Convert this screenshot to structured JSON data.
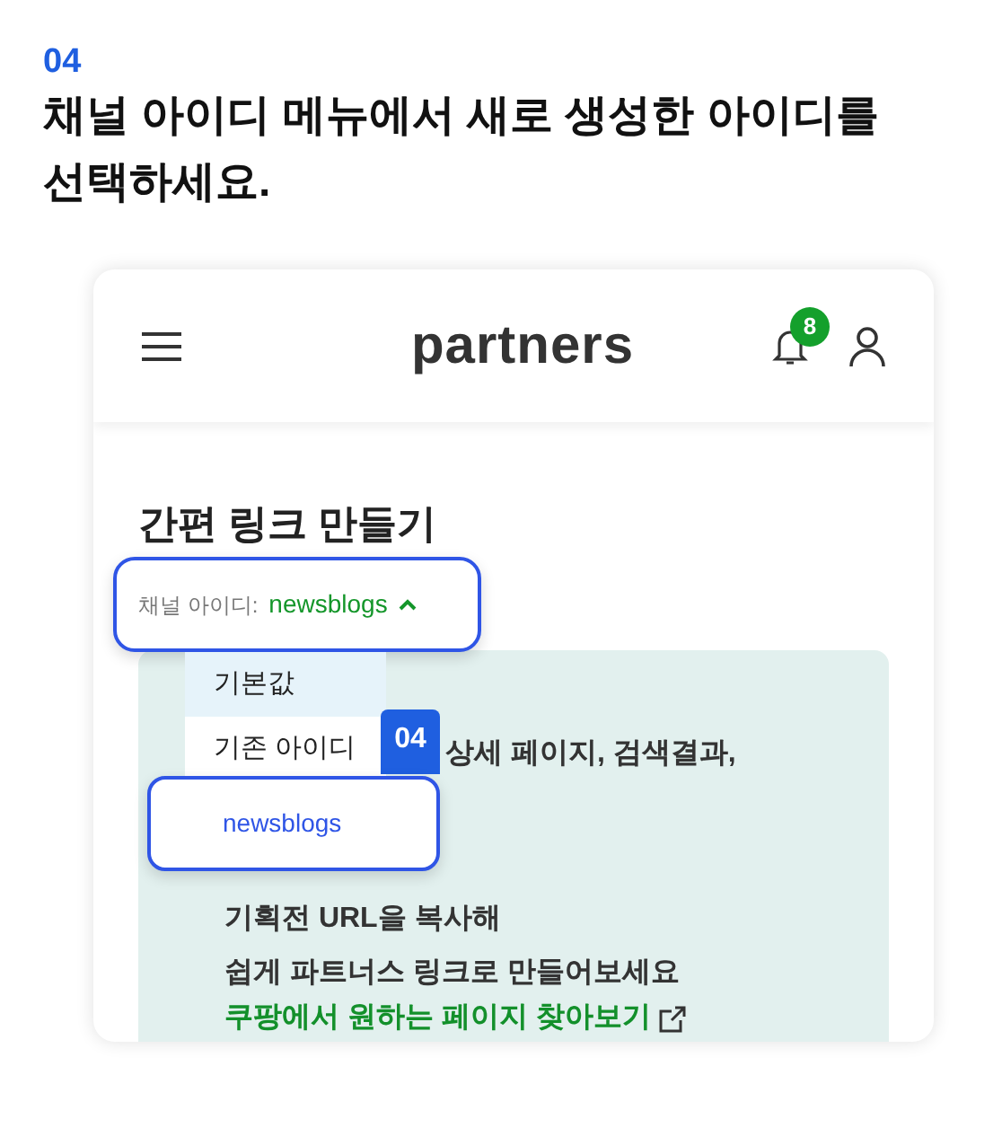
{
  "step": "04",
  "instruction": "채널 아이디 메뉴에서 새로 생성한 아이디를 선택하세요.",
  "app": {
    "logo": "partners",
    "notification_count": "8"
  },
  "page_title": "간편 링크 만들기",
  "channel_select": {
    "label": "채널 아이디:",
    "value": "newsblogs",
    "expanded": true
  },
  "dropdown": {
    "items": [
      {
        "label": "기본값",
        "highlighted": true
      },
      {
        "label": "기존 아이디",
        "highlighted": false
      }
    ]
  },
  "callout": {
    "badge": "04",
    "option": "newsblogs"
  },
  "info_panel": {
    "lines": [
      "상세 페이지, 검색결과,",
      "기획전 URL을 복사해",
      "쉽게 파트너스 링크로 만들어보세요"
    ],
    "link": "쿠팡에서 원하는 페이지 찾아보기"
  }
}
